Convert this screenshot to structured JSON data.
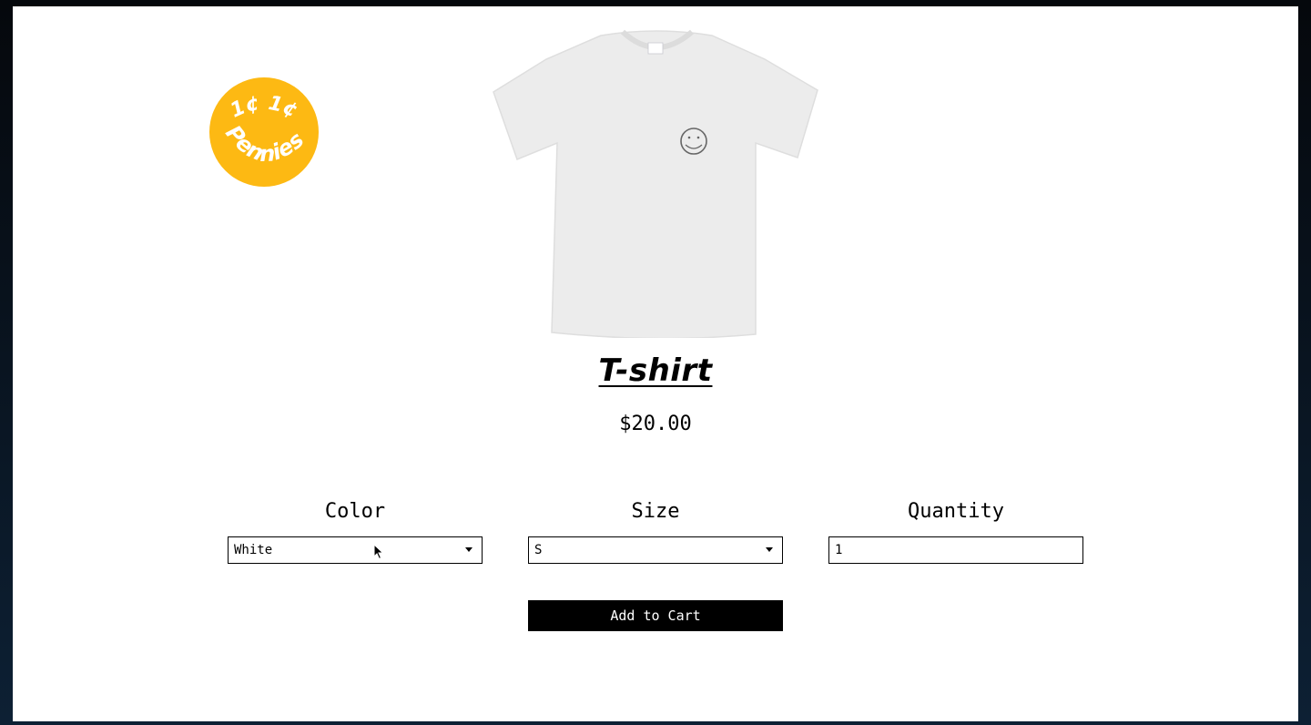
{
  "logo": {
    "top_text": "1¢ 1¢",
    "bottom_text": "Pennies",
    "color": "#fdb913"
  },
  "product": {
    "title": "T-shirt",
    "price": "$20.00",
    "image_icon": "tshirt-image"
  },
  "options": {
    "color": {
      "label": "Color",
      "value": "White"
    },
    "size": {
      "label": "Size",
      "value": "S"
    },
    "quantity": {
      "label": "Quantity",
      "value": "1"
    }
  },
  "cart": {
    "button_label": "Add to Cart"
  }
}
